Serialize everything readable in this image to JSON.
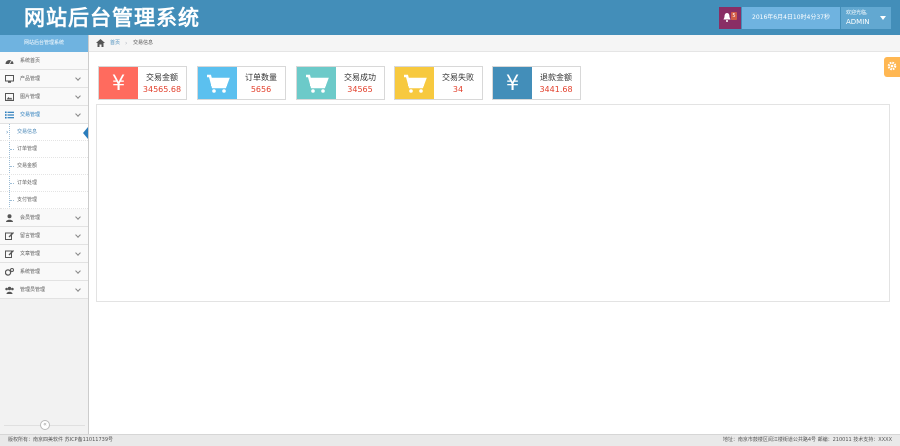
{
  "header": {
    "logo": "网站后台管理系统",
    "notification_count": "5",
    "datetime": "2016年6月4日10时4分37秒",
    "welcome": "欢迎光临,",
    "username": "ADMIN"
  },
  "sidebar": {
    "title": "网站后台管理系统",
    "items": [
      {
        "label": "系统首页",
        "icon": "dashboard-icon"
      },
      {
        "label": "产品管理",
        "icon": "desktop-icon"
      },
      {
        "label": "图片管理",
        "icon": "picture-icon"
      },
      {
        "label": "交易管理",
        "icon": "list-icon"
      },
      {
        "label": "会员管理",
        "icon": "user-icon"
      },
      {
        "label": "留言管理",
        "icon": "edit-icon"
      },
      {
        "label": "文章管理",
        "icon": "edit-icon"
      },
      {
        "label": "系统管理",
        "icon": "cogs-icon"
      },
      {
        "label": "管理员管理",
        "icon": "group-icon"
      }
    ],
    "sub_items": [
      "交易信息",
      "订单管理",
      "交易金额",
      "订单处理",
      "支付管理"
    ]
  },
  "breadcrumb": {
    "home": "首页",
    "current": "交易信息"
  },
  "cards": [
    {
      "title": "交易金额",
      "value": "34565.68",
      "color": "#ff6b5e",
      "icon": "yen-icon"
    },
    {
      "title": "订单数量",
      "value": "5656",
      "color": "#5bc0ef",
      "icon": "cart-icon"
    },
    {
      "title": "交易成功",
      "value": "34565",
      "color": "#6ccac9",
      "icon": "cart-icon"
    },
    {
      "title": "交易失败",
      "value": "34",
      "color": "#f7c93f",
      "icon": "cart-icon"
    },
    {
      "title": "退款金额",
      "value": "3441.68",
      "color": "#438eb9",
      "icon": "yen-icon"
    }
  ],
  "footer": {
    "left": "版权所有：南京四美软件 苏ICP备11011739号",
    "right": "地址：南京市鼓楼区阅江楼街道公共路4号 邮编：210011 技术支持：XXXX"
  },
  "colors": {
    "header": "#438eb9",
    "accent": "#2b7dbc",
    "settings": "#ffb752"
  }
}
